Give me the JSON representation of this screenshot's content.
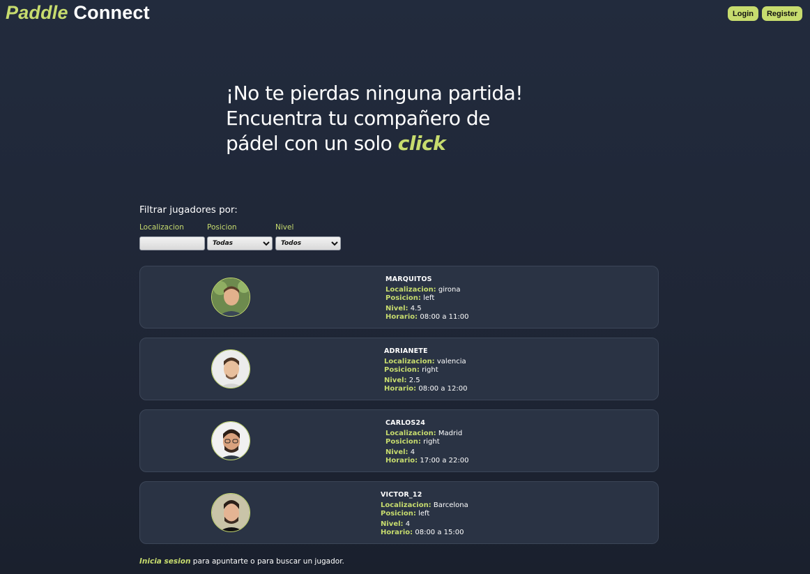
{
  "header": {
    "logo_accent": "Paddle",
    "logo_rest": "Connect",
    "login_label": "Login",
    "register_label": "Register"
  },
  "hero": {
    "line1": "¡No te pierdas ninguna partida!",
    "line2": "Encuentra tu compañero de",
    "line3_prefix": "pádel con un solo ",
    "line3_highlight": "click"
  },
  "filters": {
    "title": "Filtrar jugadores por:",
    "location_label": "Localizacion",
    "location_value": "",
    "position_label": "Posicion",
    "position_selected": "Todas",
    "level_label": "Nivel",
    "level_selected": "Todos"
  },
  "field_labels": {
    "location": "Localizacion:",
    "position": "Posicion:",
    "level": "Nivel:",
    "schedule": "Horario:"
  },
  "players": [
    {
      "name": "MARQUITOS",
      "location": "girona",
      "position": "left",
      "level": "4.5",
      "schedule": "08:00 a 11:00"
    },
    {
      "name": "ADRIANETE",
      "location": "valencia",
      "position": "right",
      "level": "2.5",
      "schedule": "08:00 a 12:00"
    },
    {
      "name": "CARLOS24",
      "location": "Madrid",
      "position": "right",
      "level": "4",
      "schedule": "17:00 a 22:00"
    },
    {
      "name": "VICTOR_12",
      "location": "Barcelona",
      "position": "left",
      "level": "4",
      "schedule": "08:00 a 15:00"
    }
  ],
  "footer": {
    "link": "Inicia sesion",
    "text": " para apuntarte o para buscar un jugador."
  },
  "colors": {
    "accent": "#c7dc6e",
    "background": "#1f2636",
    "card": "#2a3344"
  }
}
